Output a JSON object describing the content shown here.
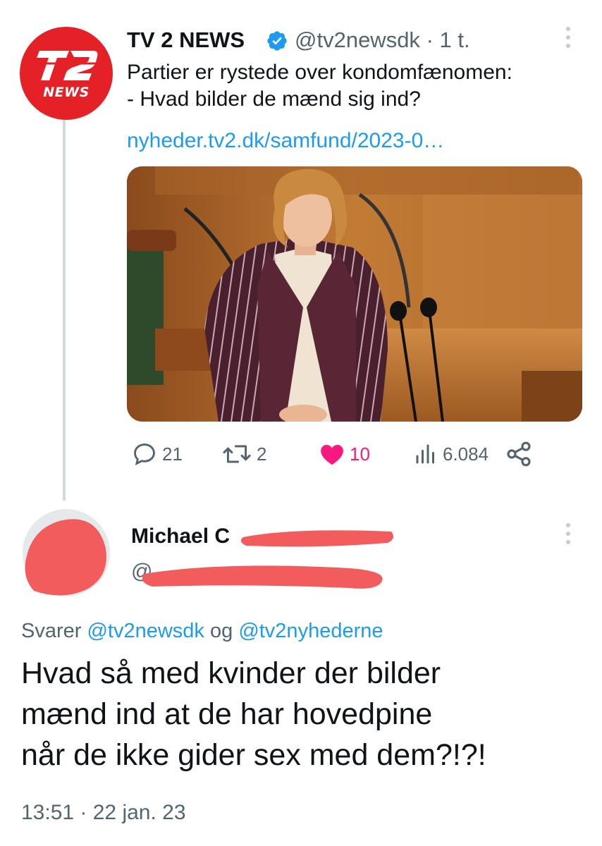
{
  "original_tweet": {
    "author_name": "TV 2 NEWS",
    "author_handle": "@tv2newsdk",
    "separator": "·",
    "time_ago": "1 t.",
    "avatar_logo_text": "NEWS",
    "text_lines": [
      "Partier er rystede over kondomfænomen:",
      "- Hvad bilder de mænd sig ind?"
    ],
    "link": "nyheder.tv2.dk/samfund/2023-0…",
    "icons": {
      "verified": "verified-badge-icon",
      "more": "more-dots-icon",
      "reply": "reply-icon",
      "retweet": "retweet-icon",
      "like": "heart-icon",
      "views": "views-icon",
      "share": "share-icon"
    },
    "actions": {
      "replies": "21",
      "retweets": "2",
      "likes": "10",
      "views": "6.084"
    },
    "colors": {
      "brand_red": "#e32127",
      "link_blue": "#1d9bf0",
      "like_pink": "#f91880",
      "muted_gray": "#536471"
    }
  },
  "reply_tweet": {
    "author_name_visible": "Michael C",
    "author_handle_visible": "@",
    "replying_prefix": "Svarer ",
    "replying_mention_1": "@tv2newsdk",
    "replying_joiner": " og ",
    "replying_mention_2": "@tv2nyhederne",
    "text_lines": [
      "Hvad så med kvinder der bilder",
      "mænd ind at de har hovedpine",
      "når de ikke gider sex med dem?!?!"
    ],
    "timestamp": "13:51 · 22 jan. 23",
    "redaction_color": "#f25c5c"
  }
}
